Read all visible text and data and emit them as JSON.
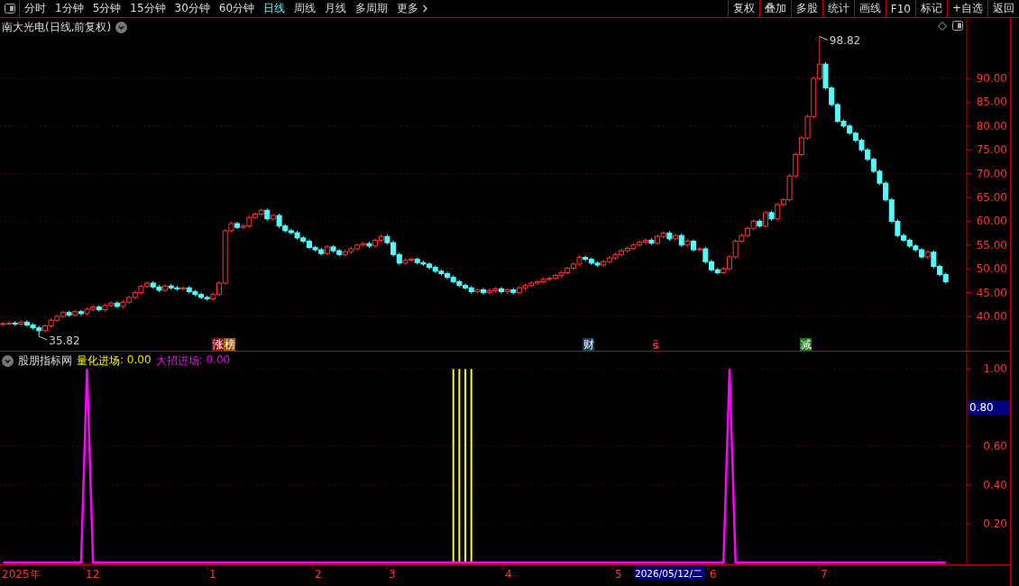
{
  "toolbar": {
    "periods": [
      {
        "label": "分时",
        "selected": false
      },
      {
        "label": "1分钟",
        "selected": false
      },
      {
        "label": "5分钟",
        "selected": false
      },
      {
        "label": "15分钟",
        "selected": false
      },
      {
        "label": "30分钟",
        "selected": false
      },
      {
        "label": "60分钟",
        "selected": false
      },
      {
        "label": "日线",
        "selected": true
      },
      {
        "label": "周线",
        "selected": false
      },
      {
        "label": "月线",
        "selected": false
      },
      {
        "label": "多周期",
        "selected": false
      }
    ],
    "more": "更多",
    "actions": [
      "复权",
      "叠加",
      "多股",
      "统计",
      "画线",
      "F10",
      "标记",
      "+自选",
      "返回"
    ]
  },
  "price_panel": {
    "title": "南大光电(日线,前复权)",
    "chart_data": {
      "type": "candlestick",
      "grid": true,
      "ylim": [
        32.61,
        102.69
      ],
      "yticks": [
        {
          "value": 90,
          "label": "90.00"
        },
        {
          "value": 85,
          "label": "85.00"
        },
        {
          "value": 80,
          "label": "80.00"
        },
        {
          "value": 75,
          "label": "75.00"
        },
        {
          "value": 70,
          "label": "70.00"
        },
        {
          "value": 65,
          "label": "65.00"
        },
        {
          "value": 60,
          "label": "60.00"
        },
        {
          "value": 55,
          "label": "55.00"
        },
        {
          "value": 50,
          "label": "50.00"
        },
        {
          "value": 45,
          "label": "45.00"
        },
        {
          "value": 40,
          "label": "40.00"
        }
      ],
      "ohlc": [
        [
          38.3,
          38.9,
          37.9,
          38.5
        ],
        [
          38.5,
          39.0,
          38.1,
          38.6
        ],
        [
          38.6,
          39.0,
          38.0,
          38.4
        ],
        [
          38.4,
          39.2,
          38.0,
          38.8
        ],
        [
          38.8,
          39.2,
          37.8,
          38.2
        ],
        [
          38.2,
          38.6,
          37.2,
          37.6
        ],
        [
          37.6,
          38.0,
          35.82,
          37.0
        ],
        [
          37.0,
          38.4,
          36.6,
          38.0
        ],
        [
          38.0,
          39.6,
          37.6,
          39.2
        ],
        [
          39.2,
          40.4,
          38.8,
          40.0
        ],
        [
          40.0,
          41.2,
          39.6,
          40.8
        ],
        [
          40.8,
          41.2,
          39.9,
          40.3
        ],
        [
          40.3,
          41.4,
          39.9,
          41.0
        ],
        [
          41.0,
          41.4,
          40.2,
          40.6
        ],
        [
          40.6,
          41.9,
          40.2,
          41.5
        ],
        [
          41.5,
          42.4,
          41.1,
          42.0
        ],
        [
          42.0,
          42.4,
          41.0,
          41.4
        ],
        [
          41.4,
          42.7,
          41.0,
          42.3
        ],
        [
          42.3,
          43.2,
          41.9,
          42.8
        ],
        [
          42.8,
          43.2,
          41.7,
          42.1
        ],
        [
          42.1,
          43.4,
          41.7,
          43.0
        ],
        [
          43.0,
          44.4,
          42.6,
          44.0
        ],
        [
          44.0,
          45.4,
          43.6,
          45.0
        ],
        [
          45.0,
          46.7,
          44.6,
          46.3
        ],
        [
          46.3,
          47.4,
          45.9,
          47.0
        ],
        [
          47.0,
          47.4,
          45.8,
          46.2
        ],
        [
          46.2,
          46.6,
          45.1,
          45.5
        ],
        [
          45.5,
          46.8,
          45.1,
          46.4
        ],
        [
          46.4,
          46.8,
          45.6,
          46.0
        ],
        [
          46.0,
          46.4,
          45.4,
          45.8
        ],
        [
          45.8,
          46.4,
          45.4,
          46.0
        ],
        [
          46.0,
          46.4,
          44.8,
          45.2
        ],
        [
          45.2,
          45.6,
          44.2,
          44.6
        ],
        [
          44.6,
          45.0,
          43.6,
          44.0
        ],
        [
          44.0,
          44.4,
          43.3,
          43.7
        ],
        [
          43.7,
          45.0,
          43.3,
          44.6
        ],
        [
          44.6,
          47.4,
          44.2,
          47.0
        ],
        [
          47.0,
          58.4,
          46.6,
          58.0
        ],
        [
          58.0,
          59.9,
          57.6,
          59.5
        ],
        [
          59.5,
          59.9,
          58.3,
          58.7
        ],
        [
          58.7,
          59.4,
          58.3,
          59.0
        ],
        [
          59.0,
          61.2,
          58.6,
          60.8
        ],
        [
          60.8,
          61.9,
          60.4,
          61.5
        ],
        [
          61.5,
          62.7,
          61.1,
          62.3
        ],
        [
          62.3,
          62.7,
          60.1,
          60.5
        ],
        [
          60.5,
          61.6,
          60.1,
          61.2
        ],
        [
          61.2,
          61.6,
          58.6,
          59.0
        ],
        [
          59.0,
          59.4,
          57.6,
          58.0
        ],
        [
          58.0,
          58.4,
          57.2,
          57.6
        ],
        [
          57.6,
          58.0,
          56.1,
          56.5
        ],
        [
          56.5,
          56.9,
          55.4,
          55.8
        ],
        [
          55.8,
          56.2,
          54.1,
          54.5
        ],
        [
          54.5,
          54.9,
          53.6,
          54.0
        ],
        [
          54.0,
          54.4,
          52.8,
          53.2
        ],
        [
          53.2,
          55.0,
          52.8,
          54.6
        ],
        [
          54.6,
          55.0,
          53.4,
          53.8
        ],
        [
          53.8,
          54.2,
          52.6,
          53.0
        ],
        [
          53.0,
          54.0,
          52.6,
          53.6
        ],
        [
          53.6,
          54.6,
          53.2,
          54.2
        ],
        [
          54.2,
          55.4,
          53.8,
          55.0
        ],
        [
          55.0,
          55.7,
          54.6,
          55.3
        ],
        [
          55.3,
          55.7,
          54.4,
          54.8
        ],
        [
          54.8,
          56.4,
          54.4,
          56.0
        ],
        [
          56.0,
          57.2,
          55.6,
          56.8
        ],
        [
          56.8,
          57.2,
          55.1,
          55.5
        ],
        [
          55.5,
          55.9,
          52.6,
          53.0
        ],
        [
          53.0,
          53.4,
          50.8,
          51.2
        ],
        [
          51.2,
          52.2,
          50.8,
          51.8
        ],
        [
          51.8,
          52.4,
          51.4,
          52.0
        ],
        [
          52.0,
          52.4,
          50.9,
          51.3
        ],
        [
          51.3,
          51.7,
          50.6,
          51.0
        ],
        [
          51.0,
          51.4,
          49.9,
          50.3
        ],
        [
          50.3,
          50.7,
          49.1,
          49.5
        ],
        [
          49.5,
          49.9,
          48.6,
          49.0
        ],
        [
          49.0,
          49.4,
          47.8,
          48.2
        ],
        [
          48.2,
          48.6,
          46.9,
          47.3
        ],
        [
          47.3,
          47.7,
          46.1,
          46.5
        ],
        [
          46.5,
          46.9,
          45.6,
          46.0
        ],
        [
          46.0,
          46.4,
          44.8,
          45.2
        ],
        [
          45.2,
          46.0,
          44.8,
          45.6
        ],
        [
          45.6,
          46.0,
          44.6,
          45.0
        ],
        [
          45.0,
          45.8,
          44.6,
          45.4
        ],
        [
          45.4,
          46.2,
          45.0,
          45.8
        ],
        [
          45.8,
          46.2,
          44.8,
          45.2
        ],
        [
          45.2,
          46.0,
          44.8,
          45.6
        ],
        [
          45.6,
          46.0,
          44.6,
          45.0
        ],
        [
          45.0,
          46.4,
          44.6,
          46.0
        ],
        [
          46.0,
          46.9,
          45.6,
          46.5
        ],
        [
          46.5,
          47.4,
          46.1,
          47.0
        ],
        [
          47.0,
          47.7,
          46.6,
          47.3
        ],
        [
          47.3,
          48.2,
          46.9,
          47.8
        ],
        [
          47.8,
          48.4,
          47.4,
          48.0
        ],
        [
          48.0,
          49.0,
          47.6,
          48.6
        ],
        [
          48.6,
          49.6,
          48.2,
          49.2
        ],
        [
          49.2,
          50.5,
          48.8,
          50.1
        ],
        [
          50.1,
          51.4,
          49.7,
          51.0
        ],
        [
          51.0,
          52.8,
          50.6,
          52.4
        ],
        [
          52.4,
          52.8,
          51.6,
          52.0
        ],
        [
          52.0,
          52.4,
          50.8,
          51.2
        ],
        [
          51.2,
          51.6,
          50.4,
          50.8
        ],
        [
          50.8,
          51.9,
          50.4,
          51.5
        ],
        [
          51.5,
          52.7,
          51.1,
          52.3
        ],
        [
          52.3,
          53.4,
          51.9,
          53.0
        ],
        [
          53.0,
          54.2,
          52.6,
          53.8
        ],
        [
          53.8,
          54.7,
          53.4,
          54.3
        ],
        [
          54.3,
          55.4,
          53.9,
          55.0
        ],
        [
          55.0,
          56.0,
          54.6,
          55.6
        ],
        [
          55.6,
          56.4,
          55.2,
          56.0
        ],
        [
          56.0,
          56.4,
          55.0,
          55.4
        ],
        [
          55.4,
          57.2,
          55.0,
          56.8
        ],
        [
          56.8,
          57.9,
          56.4,
          57.5
        ],
        [
          57.5,
          57.9,
          55.9,
          56.3
        ],
        [
          56.3,
          57.4,
          55.9,
          57.0
        ],
        [
          57.0,
          57.4,
          54.6,
          55.0
        ],
        [
          55.0,
          56.2,
          54.6,
          55.8
        ],
        [
          55.8,
          56.2,
          53.6,
          54.0
        ],
        [
          54.0,
          54.6,
          53.6,
          54.2
        ],
        [
          54.2,
          54.6,
          51.1,
          51.5
        ],
        [
          51.5,
          51.9,
          49.4,
          49.8
        ],
        [
          49.8,
          50.2,
          48.8,
          49.2
        ],
        [
          49.2,
          50.4,
          48.8,
          50.0
        ],
        [
          50.0,
          52.9,
          49.6,
          52.5
        ],
        [
          52.5,
          56.2,
          52.1,
          55.8
        ],
        [
          55.8,
          57.4,
          55.4,
          57.0
        ],
        [
          57.0,
          58.9,
          56.6,
          58.5
        ],
        [
          58.5,
          60.4,
          58.1,
          60.0
        ],
        [
          60.0,
          60.4,
          58.6,
          59.0
        ],
        [
          59.0,
          62.2,
          58.6,
          61.8
        ],
        [
          61.8,
          62.2,
          60.1,
          60.5
        ],
        [
          60.5,
          63.9,
          60.1,
          63.5
        ],
        [
          63.5,
          64.9,
          63.1,
          64.5
        ],
        [
          64.5,
          69.9,
          64.1,
          69.5
        ],
        [
          69.5,
          74.4,
          69.1,
          74.0
        ],
        [
          74.0,
          77.9,
          73.6,
          77.5
        ],
        [
          77.5,
          82.4,
          77.1,
          82.0
        ],
        [
          82.0,
          90.4,
          81.6,
          90.0
        ],
        [
          90.0,
          98.82,
          89.6,
          93.0
        ],
        [
          93.0,
          93.4,
          87.6,
          88.0
        ],
        [
          88.0,
          88.4,
          84.1,
          84.5
        ],
        [
          84.5,
          84.9,
          80.6,
          81.0
        ],
        [
          81.0,
          81.4,
          79.6,
          80.0
        ],
        [
          80.0,
          80.4,
          78.1,
          78.5
        ],
        [
          78.5,
          78.9,
          76.6,
          77.0
        ],
        [
          77.0,
          77.4,
          74.6,
          75.0
        ],
        [
          75.0,
          75.4,
          72.6,
          73.0
        ],
        [
          73.0,
          73.4,
          70.1,
          70.5
        ],
        [
          70.5,
          70.9,
          67.6,
          68.0
        ],
        [
          68.0,
          68.4,
          64.1,
          64.5
        ],
        [
          64.5,
          64.9,
          59.6,
          60.0
        ],
        [
          60.0,
          60.4,
          56.6,
          57.0
        ],
        [
          57.0,
          57.4,
          55.6,
          56.0
        ],
        [
          56.0,
          56.4,
          54.4,
          54.8
        ],
        [
          54.8,
          55.2,
          53.6,
          54.0
        ],
        [
          54.0,
          54.4,
          52.1,
          52.5
        ],
        [
          52.5,
          53.9,
          52.1,
          53.5
        ],
        [
          53.5,
          53.9,
          50.1,
          50.5
        ],
        [
          50.5,
          50.9,
          48.4,
          48.8
        ],
        [
          48.8,
          49.2,
          46.9,
          47.3
        ],
        null,
        null,
        null
      ],
      "annotations": [
        "98.82",
        "35.82"
      ]
    },
    "events": [
      {
        "kind": "tag",
        "parts": [
          {
            "text": "涨",
            "color": "#8b1010"
          },
          {
            "text": "榜",
            "color": "#9a5a10"
          }
        ]
      },
      {
        "kind": "tag",
        "parts": [
          {
            "text": "财",
            "color": "#1a3a6a"
          }
        ]
      },
      {
        "kind": "sign",
        "text": "ŝ",
        "color": "#ff2020"
      },
      {
        "kind": "tag",
        "parts": [
          {
            "text": "减",
            "color": "#1a7a1a"
          }
        ]
      }
    ]
  },
  "indicator_panel": {
    "name": "股朋指标网",
    "readouts": [
      ": 0.00",
      ": 0.00"
    ],
    "cursor": {
      "date": "2026/05/12/二",
      "value": "0.80"
    },
    "time_axis": [
      "2025年",
      "12",
      "1",
      "2",
      "3",
      "4",
      "5",
      "6",
      "7"
    ],
    "chart_data": {
      "type": "line",
      "grid": true,
      "ylim": [
        -0.01,
        1.09
      ],
      "yticks": [
        {
          "value": 1,
          "label": "1.00"
        },
        {
          "value": 0.6,
          "label": "0.60"
        },
        {
          "value": 0.4,
          "label": "0.40"
        },
        {
          "value": 0.2,
          "label": "0.20"
        }
      ],
      "series": [
        {
          "name": "量化进场",
          "type": "bar",
          "color": "#ffff00",
          "values": [
            0,
            0,
            0,
            0,
            0,
            0,
            0,
            0,
            0,
            0,
            0,
            0,
            0,
            0,
            0,
            0,
            0,
            0,
            0,
            0,
            0,
            0,
            0,
            0,
            0,
            0,
            0,
            0,
            0,
            0,
            0,
            0,
            0,
            0,
            0,
            0,
            0,
            0,
            0,
            0,
            0,
            0,
            0,
            0,
            0,
            0,
            0,
            0,
            0,
            0,
            0,
            0,
            0,
            0,
            0,
            0,
            0,
            0,
            0,
            0,
            0,
            0,
            0,
            0,
            0,
            0,
            0,
            0,
            0,
            0,
            0,
            0,
            0,
            0,
            0,
            1,
            1,
            1,
            1,
            0,
            0,
            0,
            0,
            0,
            0,
            0,
            0,
            0,
            0,
            0,
            0,
            0,
            0,
            0,
            0,
            0,
            0,
            0,
            0,
            0,
            0,
            0,
            0,
            0,
            0,
            0,
            0,
            0,
            0,
            0,
            0,
            0,
            0,
            0,
            0,
            0,
            0,
            0,
            0,
            0,
            0,
            0,
            0,
            0,
            0,
            0,
            0,
            0,
            0,
            0,
            0,
            0,
            0,
            0,
            0,
            0,
            0,
            0,
            0,
            0,
            0,
            0,
            0,
            0,
            0,
            0,
            0,
            0,
            0,
            0,
            0,
            0,
            0,
            0,
            0,
            0,
            0,
            0,
            null,
            null,
            null
          ]
        },
        {
          "name": "大招进场",
          "color": "#ff00ff",
          "values": [
            0,
            0,
            0,
            0,
            0,
            0,
            0,
            0,
            0,
            0,
            0,
            0,
            0,
            0,
            1,
            0,
            0,
            0,
            0,
            0,
            0,
            0,
            0,
            0,
            0,
            0,
            0,
            0,
            0,
            0,
            0,
            0,
            0,
            0,
            0,
            0,
            0,
            0,
            0,
            0,
            0,
            0,
            0,
            0,
            0,
            0,
            0,
            0,
            0,
            0,
            0,
            0,
            0,
            0,
            0,
            0,
            0,
            0,
            0,
            0,
            0,
            0,
            0,
            0,
            0,
            0,
            0,
            0,
            0,
            0,
            0,
            0,
            0,
            0,
            0,
            0,
            0,
            0,
            0,
            0,
            0,
            0,
            0,
            0,
            0,
            0,
            0,
            0,
            0,
            0,
            0,
            0,
            0,
            0,
            0,
            0,
            0,
            0,
            0,
            0,
            0,
            0,
            0,
            0,
            0,
            0,
            0,
            0,
            0,
            0,
            0,
            0,
            0,
            0,
            0,
            0,
            0,
            0,
            0,
            0,
            0,
            1,
            0,
            0,
            0,
            0,
            0,
            0,
            0,
            0,
            0,
            0,
            0,
            0,
            0,
            0,
            0,
            0,
            0,
            0,
            0,
            0,
            0,
            0,
            0,
            0,
            0,
            0,
            0,
            0,
            0,
            0,
            0,
            0,
            0,
            0,
            0,
            0,
            null,
            null,
            null
          ]
        }
      ]
    }
  }
}
